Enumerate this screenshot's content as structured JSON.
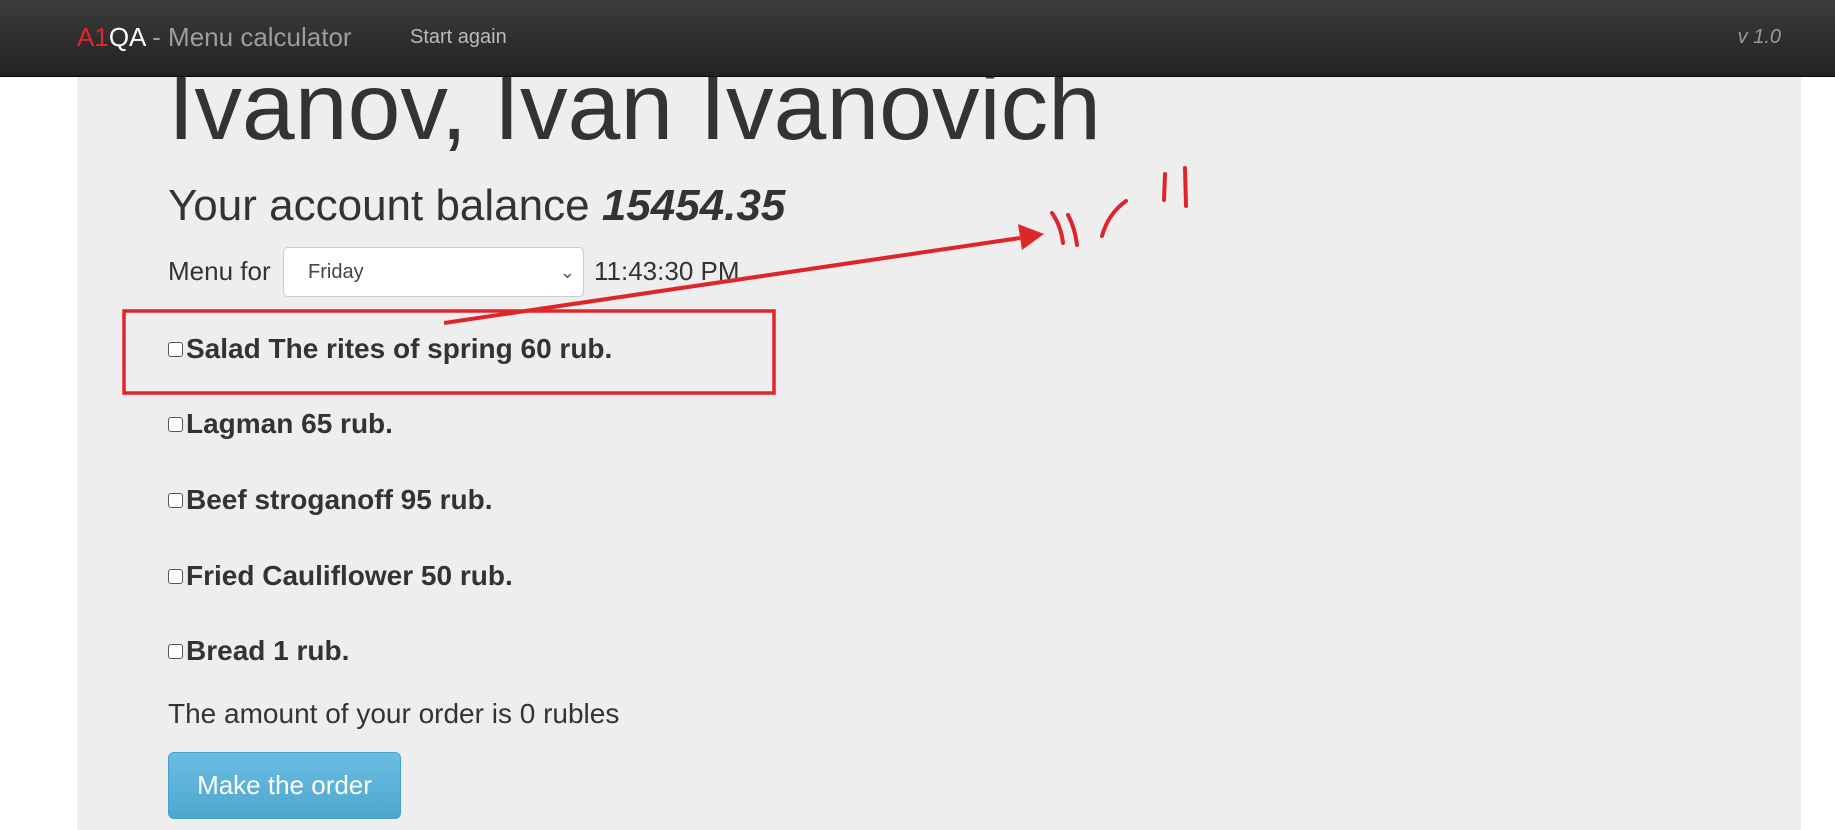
{
  "navbar": {
    "brand_part1": "A1",
    "brand_part2": "QA",
    "brand_suffix": " - Menu calculator",
    "start_again": "Start again",
    "version": "v 1.0"
  },
  "user": {
    "name": "Ivanov, Ivan Ivanovich"
  },
  "balance": {
    "label": "Your account balance ",
    "amount": "15454.35"
  },
  "menu": {
    "label": "Menu for",
    "selected_day": "Friday",
    "time": "11:43:30 PM",
    "items": [
      {
        "label": "Salad The rites of spring 60 rub.",
        "checked": false
      },
      {
        "label": "Lagman 65 rub.",
        "checked": false
      },
      {
        "label": "Beef stroganoff 95 rub.",
        "checked": false
      },
      {
        "label": "Fried Cauliflower 50 rub.",
        "checked": false
      },
      {
        "label": "Bread 1 rub.",
        "checked": false
      }
    ]
  },
  "order": {
    "total_text": "The amount of your order is 0 rubles",
    "button_label": "Make the order"
  },
  "colors": {
    "brand_red": "#e3242b",
    "annotation_red": "#e0252a",
    "button_blue": "#5bb0d8",
    "panel_bg": "#eeeeee"
  }
}
